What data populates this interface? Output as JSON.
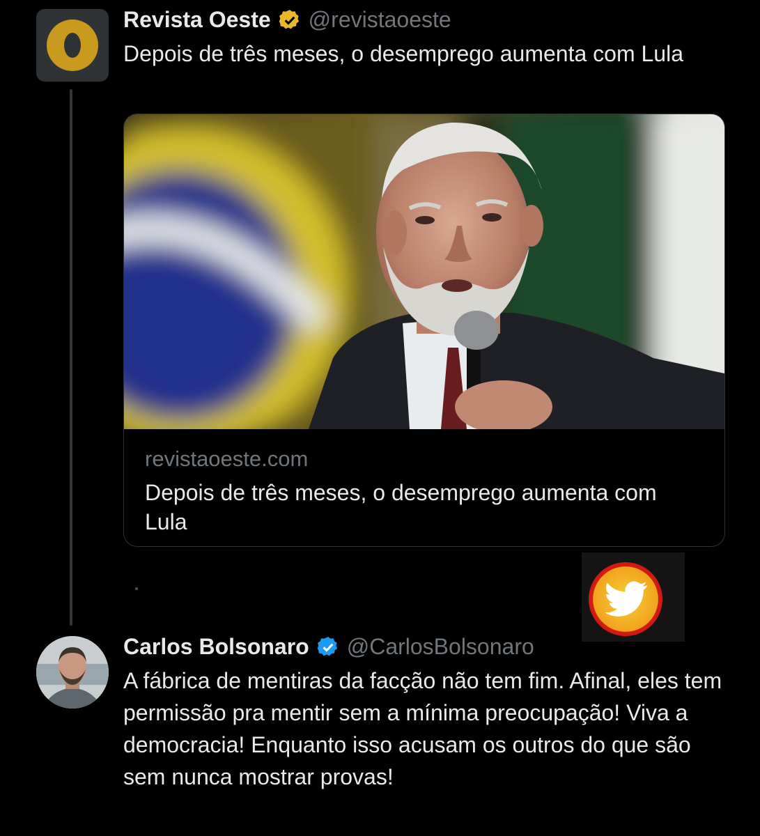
{
  "tweet1": {
    "display_name": "Revista Oeste",
    "handle": "@revistaoeste",
    "text": "Depois de três meses, o desemprego aumenta com Lula",
    "card": {
      "domain": "revistaoeste.com",
      "title": "Depois de três meses, o desemprego aumenta com Lula"
    }
  },
  "tweet2": {
    "display_name": "Carlos Bolsonaro",
    "handle": "@CarlosBolsonaro",
    "text": "A fábrica de mentiras da facção não tem fim. Afinal, eles tem permissão pra mentir sem a mínima preocupação! Viva a democracia! Enquanto isso acusam os outros do que são sem nunca mostrar provas!"
  },
  "colors": {
    "background": "#000000",
    "text": "#e7e9ea",
    "muted": "#71767b",
    "verified_gold": "#e8b829",
    "verified_blue": "#1d9bf0"
  }
}
